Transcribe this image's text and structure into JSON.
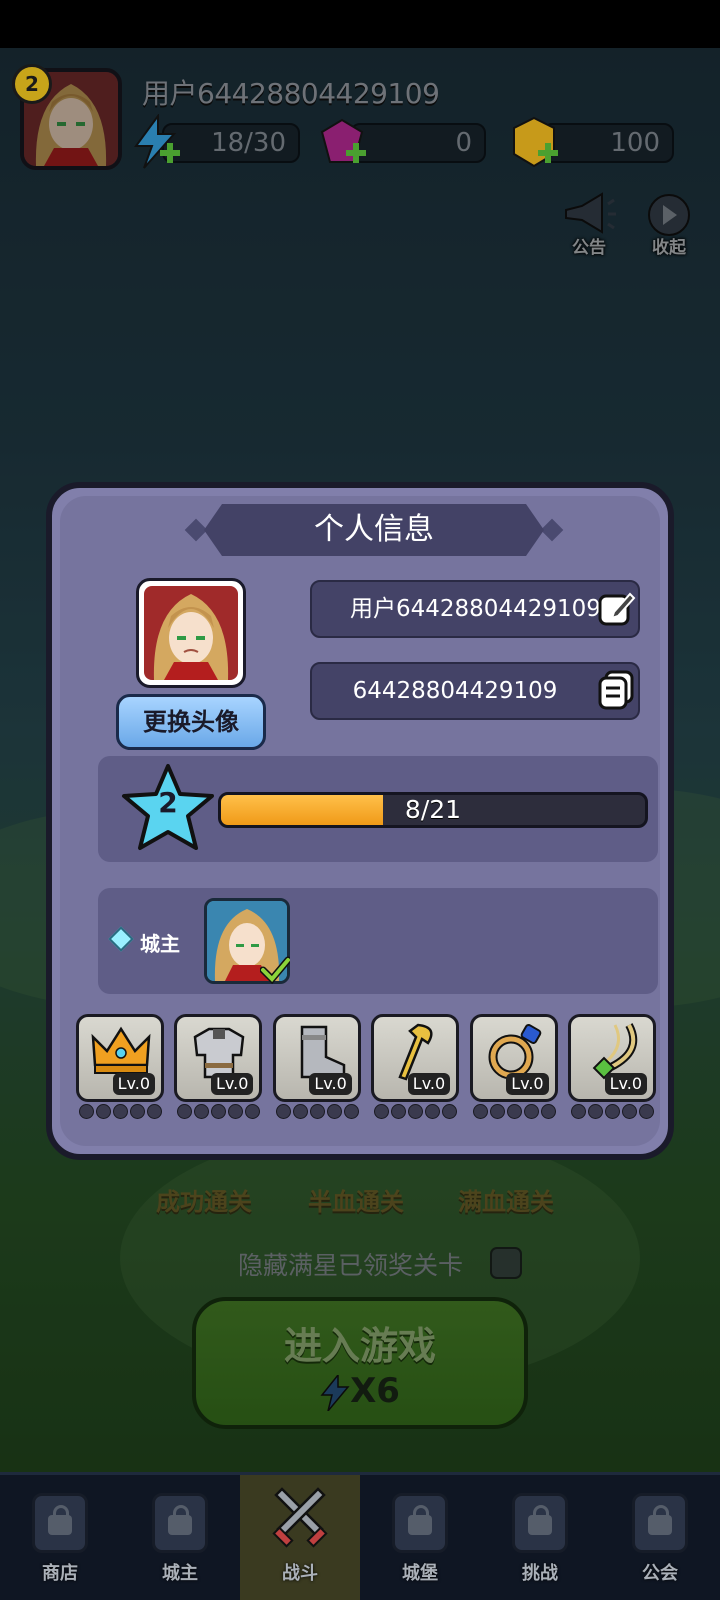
{
  "header": {
    "level": "2",
    "username": "用户64428804429109",
    "energy": "18/30",
    "gems": "0",
    "gold": "100",
    "announce_label": "公告",
    "collapse_label": "收起"
  },
  "background": {
    "clear_success": "成功通关",
    "clear_half": "半血通关",
    "clear_full": "满血通关",
    "hide_label": "隐藏满星已领奖关卡",
    "enter_game": "进入游戏",
    "enter_cost": "X6"
  },
  "modal": {
    "title": "个人信息",
    "change_avatar": "更换头像",
    "name_field": "用户64428804429109",
    "id_field": "64428804429109",
    "player_level": "2",
    "xp_text": "8/21",
    "xp_fraction": 0.381,
    "role_label": "城主",
    "equipment": [
      {
        "name": "crown-icon",
        "level": "Lv.0"
      },
      {
        "name": "armor-icon",
        "level": "Lv.0"
      },
      {
        "name": "boots-icon",
        "level": "Lv.0"
      },
      {
        "name": "staff-icon",
        "level": "Lv.0"
      },
      {
        "name": "ring-icon",
        "level": "Lv.0"
      },
      {
        "name": "necklace-icon",
        "level": "Lv.0"
      }
    ]
  },
  "nav": [
    {
      "label": "商店",
      "active": false
    },
    {
      "label": "城主",
      "active": false
    },
    {
      "label": "战斗",
      "active": true
    },
    {
      "label": "城堡",
      "active": false
    },
    {
      "label": "挑战",
      "active": false
    },
    {
      "label": "公会",
      "active": false
    }
  ],
  "colors": {
    "modal_bg": "#817fab",
    "xp_fill": "#f09a18",
    "title_bar": "#434266"
  }
}
